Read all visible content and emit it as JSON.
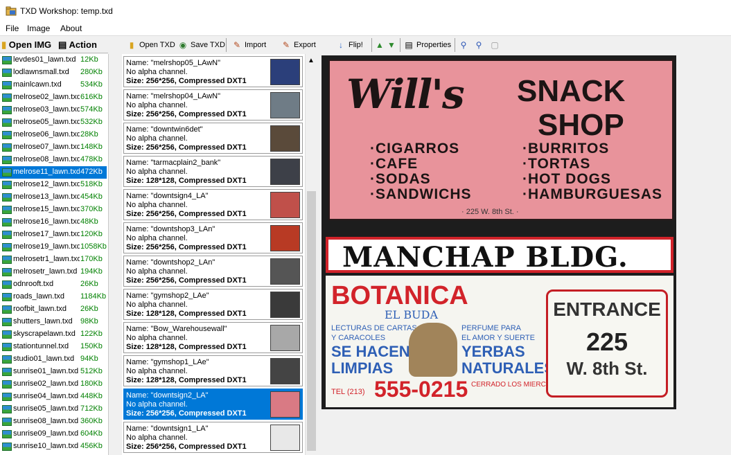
{
  "window": {
    "title": "TXD Workshop: temp.txd"
  },
  "menu": [
    "File",
    "Image",
    "About"
  ],
  "left_panel": {
    "open_button": "Open IMG",
    "action_button": "Action",
    "files": [
      {
        "name": "levdes01_lawn.txd",
        "size": "12Kb"
      },
      {
        "name": "lodlawnsmall.txd",
        "size": "280Kb"
      },
      {
        "name": "mainlcawn.txd",
        "size": "534Kb"
      },
      {
        "name": "melrose02_lawn.txd",
        "size": "616Kb"
      },
      {
        "name": "melrose03_lawn.txd",
        "size": "574Kb"
      },
      {
        "name": "melrose05_lawn.txd",
        "size": "532Kb"
      },
      {
        "name": "melrose06_lawn.txd",
        "size": "28Kb"
      },
      {
        "name": "melrose07_lawn.txd",
        "size": "148Kb"
      },
      {
        "name": "melrose08_lawn.txd",
        "size": "478Kb"
      },
      {
        "name": "melrose11_lawn.txd",
        "size": "472Kb",
        "selected": true
      },
      {
        "name": "melrose12_lawn.txd",
        "size": "518Kb"
      },
      {
        "name": "melrose13_lawn.txd",
        "size": "454Kb"
      },
      {
        "name": "melrose15_lawn.txd",
        "size": "370Kb"
      },
      {
        "name": "melrose16_lawn.txd",
        "size": "48Kb"
      },
      {
        "name": "melrose17_lawn.txd",
        "size": "120Kb"
      },
      {
        "name": "melrose19_lawn.txd",
        "size": "1058Kb"
      },
      {
        "name": "melrosetr1_lawn.txd",
        "size": "170Kb"
      },
      {
        "name": "melrosetr_lawn.txd",
        "size": "194Kb"
      },
      {
        "name": "odnrooft.txd",
        "size": "26Kb"
      },
      {
        "name": "roads_lawn.txd",
        "size": "1184Kb"
      },
      {
        "name": "roofbit_lawn.txd",
        "size": "26Kb"
      },
      {
        "name": "shutters_lawn.txd",
        "size": "98Kb"
      },
      {
        "name": "skyscrapelawn.txd",
        "size": "122Kb"
      },
      {
        "name": "stationtunnel.txd",
        "size": "150Kb"
      },
      {
        "name": "studio01_lawn.txd",
        "size": "94Kb"
      },
      {
        "name": "sunrise01_lawn.txd",
        "size": "512Kb"
      },
      {
        "name": "sunrise02_lawn.txd",
        "size": "180Kb"
      },
      {
        "name": "sunrise04_lawn.txd",
        "size": "448Kb"
      },
      {
        "name": "sunrise05_lawn.txd",
        "size": "712Kb"
      },
      {
        "name": "sunrise08_lawn.txd",
        "size": "360Kb"
      },
      {
        "name": "sunrise09_lawn.txd",
        "size": "604Kb"
      },
      {
        "name": "sunrise10_lawn.txd",
        "size": "456Kb"
      }
    ]
  },
  "toolbar": {
    "open_txd": "Open TXD",
    "save_txd": "Save TXD",
    "import": "Import",
    "export": "Export",
    "flip": "Flip!",
    "properties": "Properties"
  },
  "textures": [
    {
      "name": "Name: \"melrshop05_LAwN\"",
      "alpha": "No alpha channel.",
      "size": "Size: 256*256, Compressed DXT1",
      "thumb_color": "#2b3f7a"
    },
    {
      "name": "Name: \"melrshop04_LAwN\"",
      "alpha": "No alpha channel.",
      "size": "Size: 256*256, Compressed DXT1",
      "thumb_color": "#6f7c86"
    },
    {
      "name": "Name: \"downtwin6det\"",
      "alpha": "No alpha channel.",
      "size": "Size: 256*256, Compressed DXT1",
      "thumb_color": "#5a4a3a"
    },
    {
      "name": "Name: \"tarmacplain2_bank\"",
      "alpha": "No alpha channel.",
      "size": "Size: 128*128, Compressed DXT1",
      "thumb_color": "#3d4048"
    },
    {
      "name": "Name: \"downtsign4_LA\"",
      "alpha": "No alpha channel.",
      "size": "Size: 256*256, Compressed DXT1",
      "thumb_color": "#c0504a"
    },
    {
      "name": "Name: \"downtshop3_LAn\"",
      "alpha": "No alpha channel.",
      "size": "Size: 256*256, Compressed DXT1",
      "thumb_color": "#b83a24"
    },
    {
      "name": "Name: \"downtshop2_LAn\"",
      "alpha": "No alpha channel.",
      "size": "Size: 256*256, Compressed DXT1",
      "thumb_color": "#555555"
    },
    {
      "name": "Name: \"gymshop2_LAe\"",
      "alpha": "No alpha channel.",
      "size": "Size: 128*128, Compressed DXT1",
      "thumb_color": "#3a3a3a"
    },
    {
      "name": "Name: \"Bow_Warehousewall\"",
      "alpha": "No alpha channel.",
      "size": "Size: 128*128, Compressed DXT1",
      "thumb_color": "#a8a8a8"
    },
    {
      "name": "Name: \"gymshop1_LAe\"",
      "alpha": "No alpha channel.",
      "size": "Size: 128*128, Compressed DXT1",
      "thumb_color": "#444444"
    },
    {
      "name": "Name: \"downtsign2_LA\"",
      "alpha": "No alpha channel.",
      "size": "Size: 256*256, Compressed DXT1",
      "thumb_color": "#d97a84",
      "selected": true
    },
    {
      "name": "Name: \"downtsign1_LA\"",
      "alpha": "No alpha channel.",
      "size": "Size: 256*256, Compressed DXT1",
      "thumb_color": "#e8e8e8"
    }
  ],
  "preview": {
    "will": "Will's",
    "snack": "SNACK",
    "shop": "SHOP",
    "menu_left": [
      "·CIGARROS",
      "·CAFE",
      "·SODAS",
      "·SANDWICHS"
    ],
    "menu_right": [
      "·BURRITOS",
      "·TORTAS",
      "·HOT DOGS",
      "·HAMBURGUESAS"
    ],
    "addr": "· 225 W. 8th St. ·",
    "manchap": "MANCHAP BLDG.",
    "botanica": "BOTANICA",
    "elbuda": "EL BUDA",
    "lecturas": "LECTURAS DE CARTAS",
    "perfume": "PERFUME PARA",
    "caracoles": "Y CARACOLES",
    "amor": "EL AMOR Y SUERTE",
    "se_hacen": "SE HACEN",
    "limpias": "LIMPIAS",
    "yerbas": "YERBAS",
    "naturales": "NATURALES",
    "tel": "TEL (213)",
    "phone": "555-0215",
    "cerrado": "CERRADO LOS MIERCOLES",
    "entrance": "ENTRANCE",
    "number": "225",
    "street": "W. 8th St."
  }
}
